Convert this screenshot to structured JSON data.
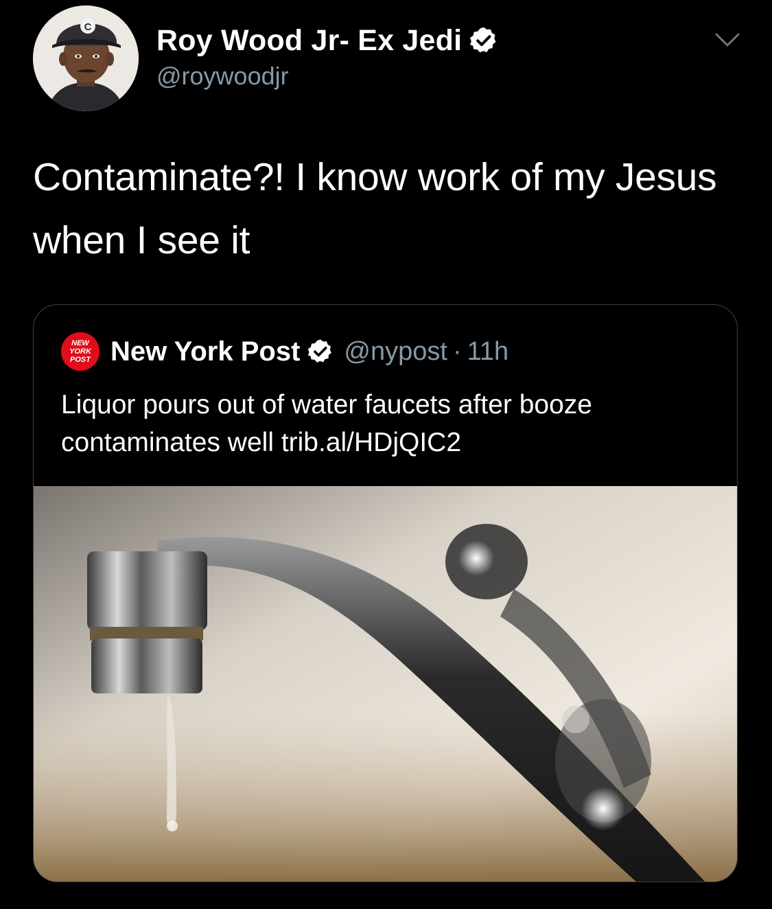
{
  "tweet": {
    "author": {
      "display_name": "Roy Wood Jr- Ex Jedi",
      "handle": "@roywoodjr",
      "avatar_cap_letter": "C",
      "verified": true
    },
    "text": "Contaminate?! I know work of my Jesus when I see it",
    "menu_icon": "chevron-down-icon"
  },
  "quoted_tweet": {
    "logo_text": [
      "NEW",
      "YORK",
      "POST"
    ],
    "display_name": "New York Post",
    "handle": "@nypost",
    "separator": "·",
    "time": "11h",
    "verified": true,
    "text": "Liquor pours out of water faucets after booze contaminates well trib.al/HDjQIC2",
    "image_icon": "faucet-photo"
  },
  "colors": {
    "background": "#000000",
    "secondary_text": "#8899a6",
    "border": "#38444d",
    "verified_badge": "#ffffff",
    "nypost_red": "#e00d1a"
  }
}
